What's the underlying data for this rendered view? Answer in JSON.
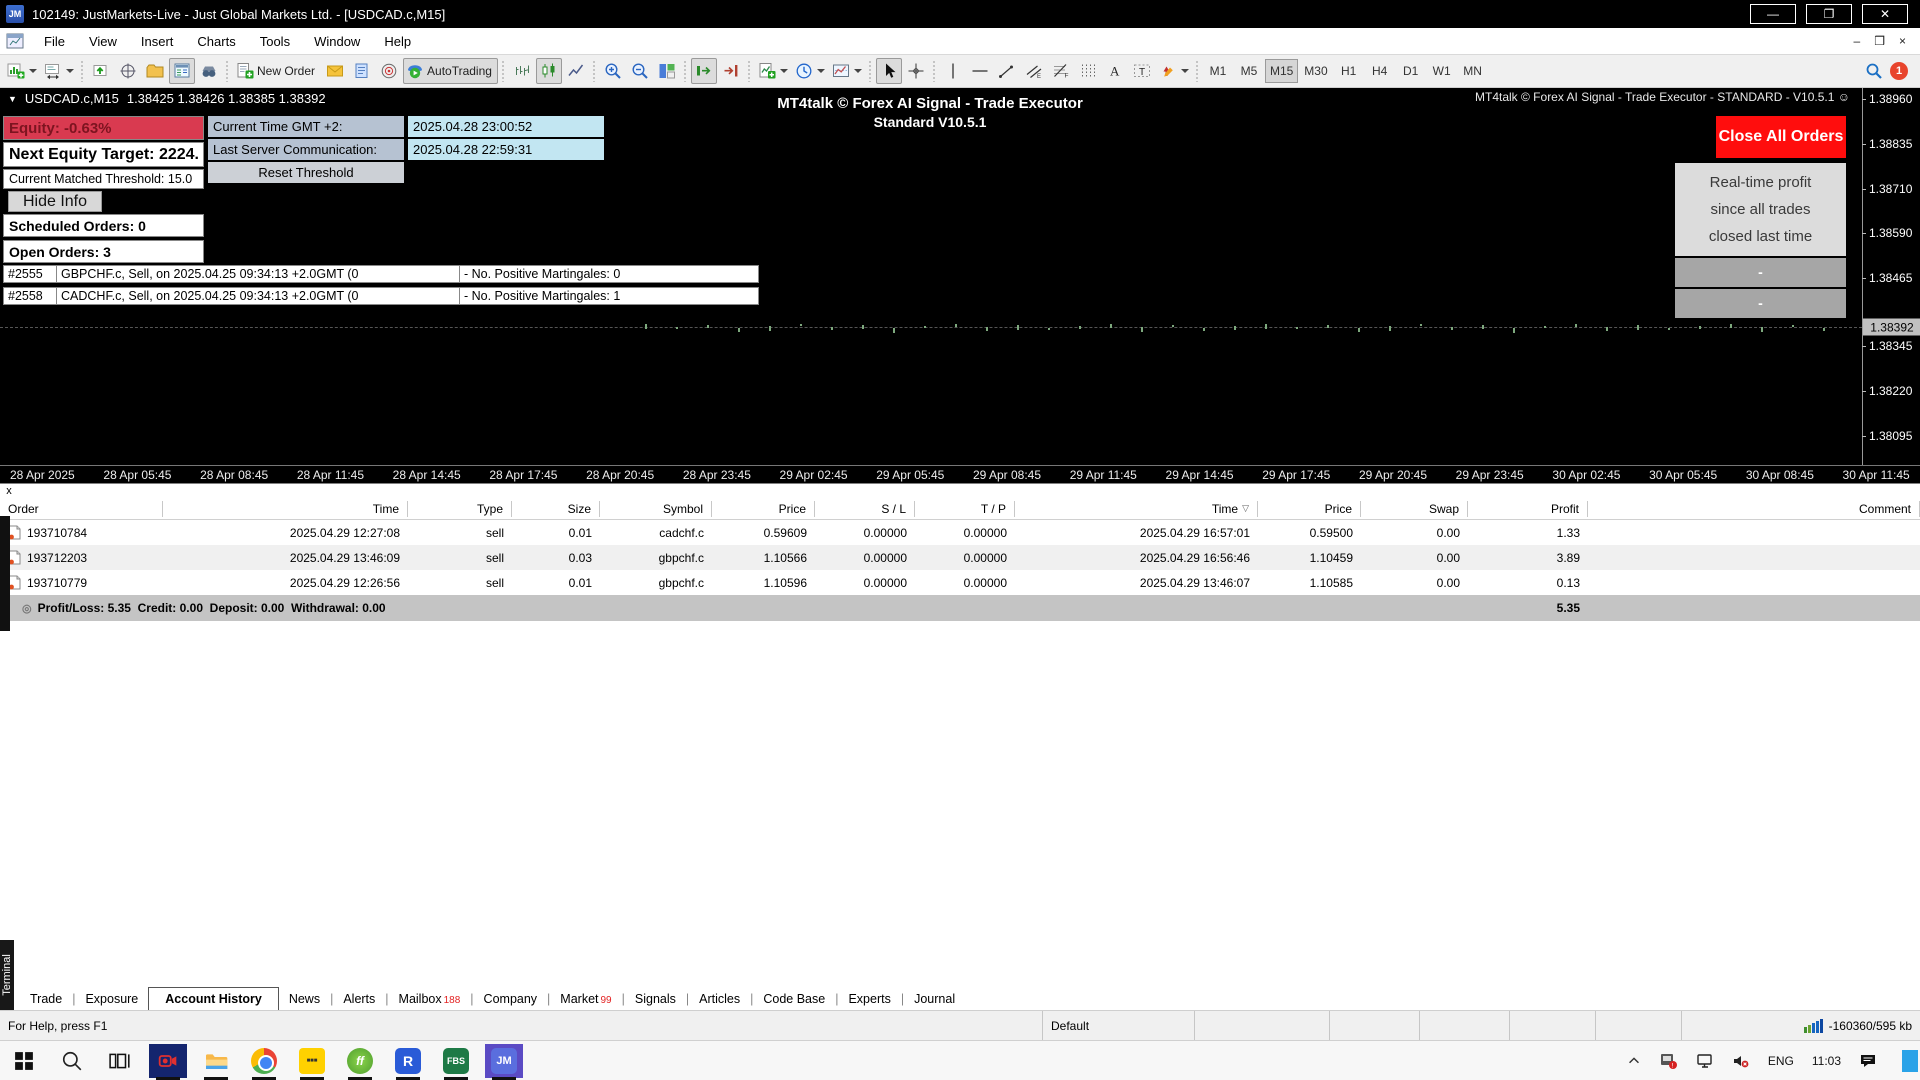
{
  "window": {
    "logo": "JM",
    "title": "102149: JustMarkets-Live - Just Global Markets Ltd. - [USDCAD.c,M15]"
  },
  "menu": {
    "items": [
      "File",
      "View",
      "Insert",
      "Charts",
      "Tools",
      "Window",
      "Help"
    ]
  },
  "toolbar": {
    "new_order_label": "New Order",
    "autotrading_label": "AutoTrading",
    "timeframes": [
      "M1",
      "M5",
      "M15",
      "M30",
      "H1",
      "H4",
      "D1",
      "W1",
      "MN"
    ],
    "active_timeframe": "M15",
    "notification_count": "1"
  },
  "chart": {
    "symbol": "USDCAD.c,M15",
    "ohlc": "1.38425 1.38426 1.38385 1.38392",
    "watermark": "MT4talk © Forex AI Signal - Trade Executor - STANDARD - V10.5.1 ☺",
    "title_line1": "MT4talk © Forex AI Signal - Trade Executor",
    "title_line2": "Standard V10.5.1",
    "info": {
      "equity": "Equity: -0.63%",
      "next_target": "Next Equity Target: 2224.",
      "threshold": "Current Matched Threshold: 15.0",
      "hide_info": "Hide Info",
      "scheduled": "Scheduled Orders: 0",
      "open_orders": "Open Orders: 3",
      "current_time_label": "Current Time GMT +2:",
      "current_time_value": "2025.04.28 23:00:52",
      "last_comm_label": "Last Server Communication:",
      "last_comm_value": "2025.04.28 22:59:31",
      "reset_button": "Reset Threshold",
      "orders": [
        {
          "id": "#2555",
          "text": "GBPCHF.c, Sell, on 2025.04.25 09:34:13 +2.0GMT  (0",
          "martingales": "- No. Positive Martingales: 0"
        },
        {
          "id": "#2558",
          "text": "CADCHF.c, Sell, on 2025.04.25 09:34:13 +2.0GMT  (0",
          "martingales": "- No. Positive Martingales: 1"
        }
      ]
    },
    "close_all_label": "Close All Orders",
    "profit_panel": {
      "lines": [
        "Real-time profit",
        "since all trades",
        "closed last time"
      ],
      "bars": [
        "-",
        "-"
      ]
    },
    "price_axis": {
      "ticks": [
        "1.38960",
        "1.38835",
        "1.38710",
        "1.38590",
        "1.38465",
        "1.38345",
        "1.38220",
        "1.38095"
      ],
      "current": "1.38392"
    },
    "time_axis": [
      "28 Apr 2025",
      "28 Apr 05:45",
      "28 Apr 08:45",
      "28 Apr 11:45",
      "28 Apr 14:45",
      "28 Apr 17:45",
      "28 Apr 20:45",
      "28 Apr 23:45",
      "29 Apr 02:45",
      "29 Apr 05:45",
      "29 Apr 08:45",
      "29 Apr 11:45",
      "29 Apr 14:45",
      "29 Apr 17:45",
      "29 Apr 20:45",
      "29 Apr 23:45",
      "30 Apr 02:45",
      "30 Apr 05:45",
      "30 Apr 08:45",
      "30 Apr 11:45"
    ]
  },
  "terminal": {
    "columns": [
      "Order",
      "Time",
      "Type",
      "Size",
      "Symbol",
      "Price",
      "S / L",
      "T / P",
      "Time",
      "Price",
      "Swap",
      "Profit",
      "Comment"
    ],
    "sort_column_index": 8,
    "rows": [
      {
        "order": "193710784",
        "time": "2025.04.29 12:27:08",
        "type": "sell",
        "size": "0.01",
        "symbol": "cadchf.c",
        "price": "0.59609",
        "sl": "0.00000",
        "tp": "0.00000",
        "close_time": "2025.04.29 16:57:01",
        "close_price": "0.59500",
        "swap": "0.00",
        "profit": "1.33",
        "comment": ""
      },
      {
        "order": "193712203",
        "time": "2025.04.29 13:46:09",
        "type": "sell",
        "size": "0.03",
        "symbol": "gbpchf.c",
        "price": "1.10566",
        "sl": "0.00000",
        "tp": "0.00000",
        "close_time": "2025.04.29 16:56:46",
        "close_price": "1.10459",
        "swap": "0.00",
        "profit": "3.89",
        "comment": ""
      },
      {
        "order": "193710779",
        "time": "2025.04.29 12:26:56",
        "type": "sell",
        "size": "0.01",
        "symbol": "gbpchf.c",
        "price": "1.10596",
        "sl": "0.00000",
        "tp": "0.00000",
        "close_time": "2025.04.29 13:46:07",
        "close_price": "1.10585",
        "swap": "0.00",
        "profit": "0.13",
        "comment": ""
      }
    ],
    "summary": {
      "text": "Profit/Loss: 5.35  Credit: 0.00  Deposit: 0.00  Withdrawal: 0.00",
      "profit_total": "5.35"
    },
    "tabs": [
      {
        "label": "Trade"
      },
      {
        "label": "Exposure"
      },
      {
        "label": "Account History",
        "active": true
      },
      {
        "label": "News"
      },
      {
        "label": "Alerts"
      },
      {
        "label": "Mailbox",
        "badge": "188"
      },
      {
        "label": "Company"
      },
      {
        "label": "Market",
        "badge": "99"
      },
      {
        "label": "Signals"
      },
      {
        "label": "Articles"
      },
      {
        "label": "Code Base"
      },
      {
        "label": "Experts"
      },
      {
        "label": "Journal"
      }
    ],
    "vertical_label": "Terminal"
  },
  "statusbar": {
    "help": "For Help, press F1",
    "profile": "Default",
    "traffic": "-160360/595 kb"
  },
  "taskbar": {
    "apps": [
      {
        "name": "screen-recorder-app",
        "kind": "recorder"
      },
      {
        "name": "file-explorer-app",
        "kind": "explorer"
      },
      {
        "name": "chrome-app",
        "kind": "chrome"
      },
      {
        "name": "yellow-app",
        "kind": "yellow"
      },
      {
        "name": "ff-app",
        "kind": "ff",
        "label": "ff"
      },
      {
        "name": "r-app",
        "kind": "r",
        "label": "R"
      },
      {
        "name": "fbs-app",
        "kind": "fbs",
        "label": "FBS"
      },
      {
        "name": "jm-app",
        "kind": "jm",
        "label": "JM"
      }
    ],
    "tray": {
      "language": "ENG",
      "time": "11:03"
    }
  }
}
